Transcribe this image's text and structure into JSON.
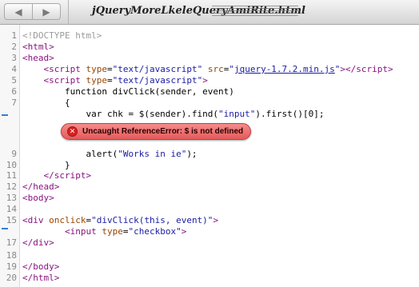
{
  "toolbar": {
    "back_icon": "◀",
    "forward_icon": "▶",
    "filename": "jQueryMoreLkeleQueryAmiRite.html"
  },
  "lines": [
    {
      "num": "1",
      "html": "<span class=\"cmt\">&lt;!DOCTYPE html&gt;</span>"
    },
    {
      "num": "2",
      "html": "<span class=\"tag\">&lt;html&gt;</span>"
    },
    {
      "num": "3",
      "html": "<span class=\"tag\">&lt;head&gt;</span>"
    },
    {
      "num": "4",
      "html": "    <span class=\"tag\">&lt;script</span> <span class=\"attr\">type</span>=<span class=\"str\">\"text/javascript\"</span> <span class=\"attr\">src</span>=<span class=\"str\">\"</span><span class=\"link\">jquery-1.7.2.min.js</span><span class=\"str\">\"</span><span class=\"tag\">&gt;&lt;/script&gt;</span>"
    },
    {
      "num": "5",
      "html": "    <span class=\"tag\">&lt;script</span> <span class=\"attr\">type</span>=<span class=\"str\">\"text/javascript\"</span><span class=\"tag\">&gt;</span>"
    },
    {
      "num": "6",
      "html": "        function divClick(sender, event)"
    },
    {
      "num": "7",
      "html": "        {"
    },
    {
      "num": "",
      "html": "            var chk = $(sender).find(<span class=\"str\">\"input\"</span>).first()[0];"
    },
    {
      "num": "9",
      "html": "            alert(<span class=\"str\">\"Works in ie\"</span>);"
    },
    {
      "num": "10",
      "html": "        }"
    },
    {
      "num": "11",
      "html": "    <span class=\"tag\">&lt;/script&gt;</span>"
    },
    {
      "num": "12",
      "html": "<span class=\"tag\">&lt;/head&gt;</span>"
    },
    {
      "num": "13",
      "html": "<span class=\"tag\">&lt;body&gt;</span>"
    },
    {
      "num": "14",
      "html": ""
    },
    {
      "num": "15",
      "html": "<span class=\"tag\">&lt;div</span> <span class=\"attr\">onclick</span>=<span class=\"str\">\"divClick(this, event)\"</span><span class=\"tag\">&gt;</span>"
    },
    {
      "num": "",
      "html": "        <span class=\"tag\">&lt;input</span> <span class=\"attr\">type</span>=<span class=\"str\">\"checkbox\"</span><span class=\"tag\">&gt;</span>"
    },
    {
      "num": "17",
      "html": "<span class=\"tag\">&lt;/div&gt;</span>"
    },
    {
      "num": "18",
      "html": ""
    },
    {
      "num": "19",
      "html": "<span class=\"tag\">&lt;/body&gt;</span>"
    },
    {
      "num": "20",
      "html": "<span class=\"tag\">&lt;/html&gt;</span>"
    }
  ],
  "error": {
    "icon": "✕",
    "message": "Uncaught ReferenceError: $ is not defined"
  }
}
